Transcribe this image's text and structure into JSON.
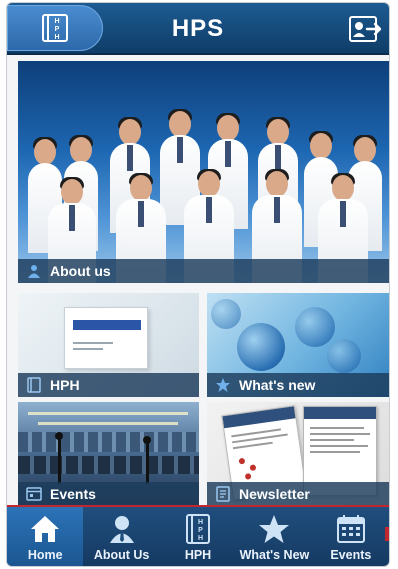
{
  "header": {
    "title": "HPS",
    "menu_icon_letters": [
      "H",
      "P",
      "H"
    ]
  },
  "tiles": {
    "about": {
      "label": "About us",
      "icon": "person-icon"
    },
    "hph": {
      "label": "HPH",
      "icon": "book-icon",
      "cover_text": "Haematology\nPatient Handbook"
    },
    "whats_new": {
      "label": "What's new",
      "icon": "star-icon"
    },
    "events": {
      "label": "Events",
      "icon": "calendar-icon"
    },
    "newsletter": {
      "label": "Newsletter",
      "icon": "document-icon"
    }
  },
  "tabbar": {
    "tabs": [
      {
        "label": "Home",
        "icon": "home-icon",
        "active": true
      },
      {
        "label": "About Us",
        "icon": "person-icon",
        "active": false
      },
      {
        "label": "HPH",
        "icon": "book-icon",
        "active": false
      },
      {
        "label": "What's New",
        "icon": "star-icon",
        "active": false
      },
      {
        "label": "Events",
        "icon": "calendar-icon",
        "active": false
      }
    ]
  },
  "colors": {
    "header": "#1d5b91",
    "tabbar": "#204e7e",
    "accent_red": "#c2262f",
    "label_overlay": "#1c3c5c"
  }
}
